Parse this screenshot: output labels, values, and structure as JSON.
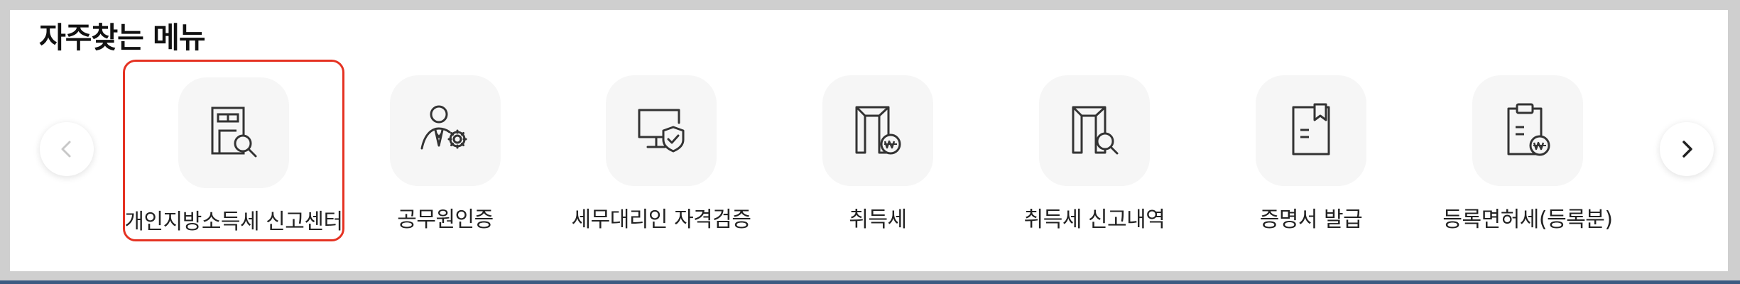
{
  "section": {
    "title": "자주찾는 메뉴"
  },
  "nav": {
    "prev_icon": "chevron-left",
    "next_icon": "chevron-right"
  },
  "menu": [
    {
      "label": "개인지방소득세 신고센터",
      "icon": "building-search-icon",
      "selected": true
    },
    {
      "label": "공무원인증",
      "icon": "person-gear-icon",
      "selected": false
    },
    {
      "label": "세무대리인 자격검증",
      "icon": "monitor-shield-icon",
      "selected": false
    },
    {
      "label": "취득세",
      "icon": "building-won-icon",
      "selected": false
    },
    {
      "label": "취득세 신고내역",
      "icon": "building-search-icon",
      "selected": false
    },
    {
      "label": "증명서 발급",
      "icon": "bookmark-document-icon",
      "selected": false
    },
    {
      "label": "등록면허세(등록분)",
      "icon": "clipboard-won-icon",
      "selected": false
    }
  ],
  "colors": {
    "selected_border": "#e53222",
    "tile_bg": "#f6f6f6",
    "icon_stroke": "#333333"
  }
}
